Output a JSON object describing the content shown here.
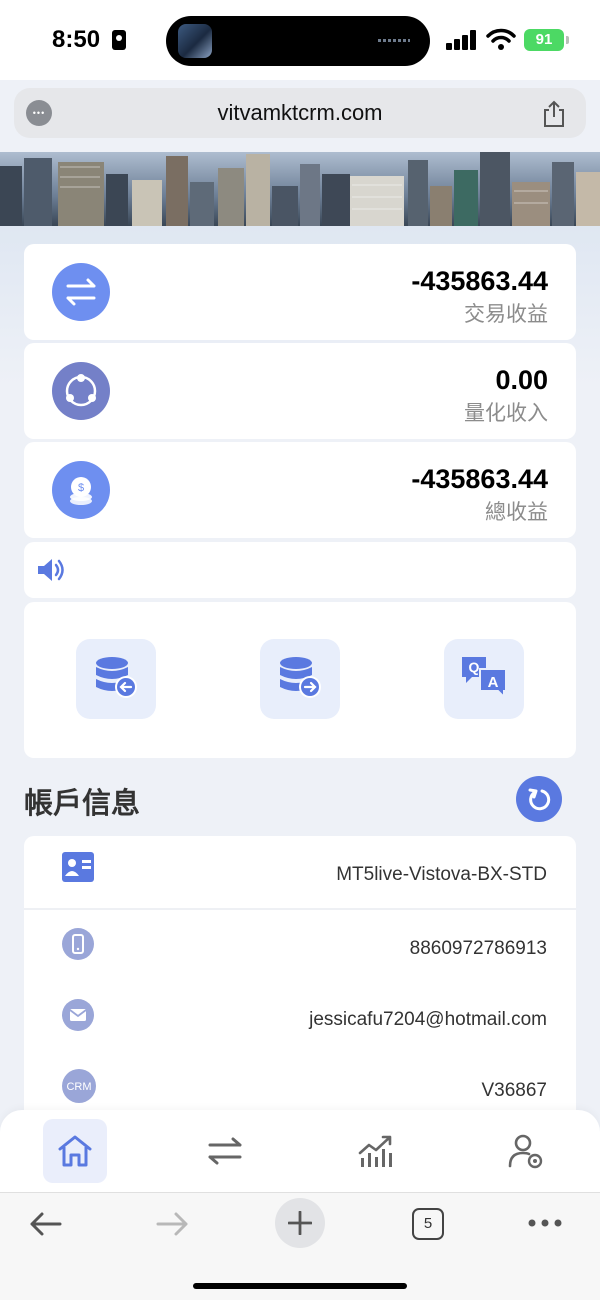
{
  "status_bar": {
    "time": "8:50",
    "battery": "91"
  },
  "browser": {
    "url": "vitvamktcrm.com",
    "tab_count": "5"
  },
  "stats": [
    {
      "icon": "transfer-arrows-icon",
      "value": "-435863.44",
      "label": "交易收益",
      "color": "#6e8ff0"
    },
    {
      "icon": "network-nodes-icon",
      "value": "0.00",
      "label": "量化收入",
      "color": "#7480c8"
    },
    {
      "icon": "coin-stack-icon",
      "value": "-435863.44",
      "label": "總收益",
      "color": "#6e8ff0"
    }
  ],
  "quick_actions": [
    {
      "name": "deposit-button",
      "icon": "database-in-icon"
    },
    {
      "name": "withdraw-button",
      "icon": "database-out-icon"
    },
    {
      "name": "faq-button",
      "icon": "qa-chat-icon"
    }
  ],
  "account": {
    "title": "帳戶信息",
    "rows": [
      {
        "icon": "id-card-icon",
        "value": "MT5live-Vistova-BX-STD"
      },
      {
        "icon": "phone-icon",
        "value": "8860972786913"
      },
      {
        "icon": "mail-icon",
        "value": "jessicafu7204@hotmail.com"
      },
      {
        "icon": "crm-icon",
        "icon_text": "CRM",
        "value": "V36867"
      }
    ]
  },
  "bottom_nav": [
    {
      "name": "nav-home",
      "icon": "home-icon",
      "active": true
    },
    {
      "name": "nav-trade",
      "icon": "transfer-icon",
      "active": false
    },
    {
      "name": "nav-market",
      "icon": "chart-icon",
      "active": false
    },
    {
      "name": "nav-profile",
      "icon": "user-settings-icon",
      "active": false
    }
  ],
  "colors": {
    "accent": "#5a79e0",
    "icon_blue": "#6e8ff0",
    "page_bg": "#eef1f7"
  }
}
